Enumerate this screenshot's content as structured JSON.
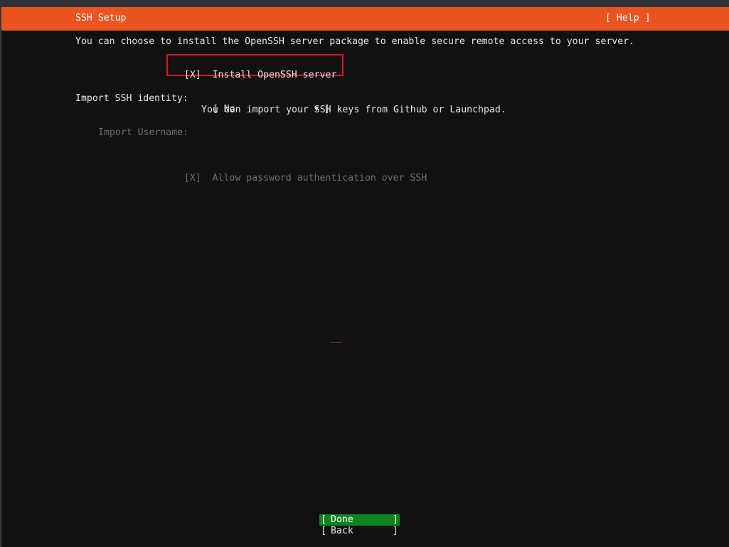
{
  "header": {
    "title": "SSH Setup",
    "help": "[ Help ]"
  },
  "intro": "You can choose to install the OpenSSH server package to enable secure remote access to your server.",
  "install_openssh": {
    "checkbox": "[X]",
    "label": "Install OpenSSH server",
    "checked": true
  },
  "import_identity": {
    "label": "Import SSH identity:",
    "open_bracket": "[ No",
    "arrow": "▼",
    "close_bracket": "]",
    "selected_value": "No",
    "help_text": "You can import your SSH keys from Github or Launchpad."
  },
  "import_username": {
    "label": "Import Username:",
    "value": ""
  },
  "allow_password": {
    "checkbox": "[X]",
    "label": "Allow password authentication over SSH",
    "checked": true
  },
  "buttons": {
    "done": {
      "open": "[",
      "label": "Done",
      "close": "]"
    },
    "back": {
      "open": "[",
      "label": "Back",
      "close": "]"
    }
  },
  "colors": {
    "header_bg": "#e95420",
    "done_bg": "#0e8420",
    "highlight_border": "#d5171f",
    "background": "#111111"
  }
}
